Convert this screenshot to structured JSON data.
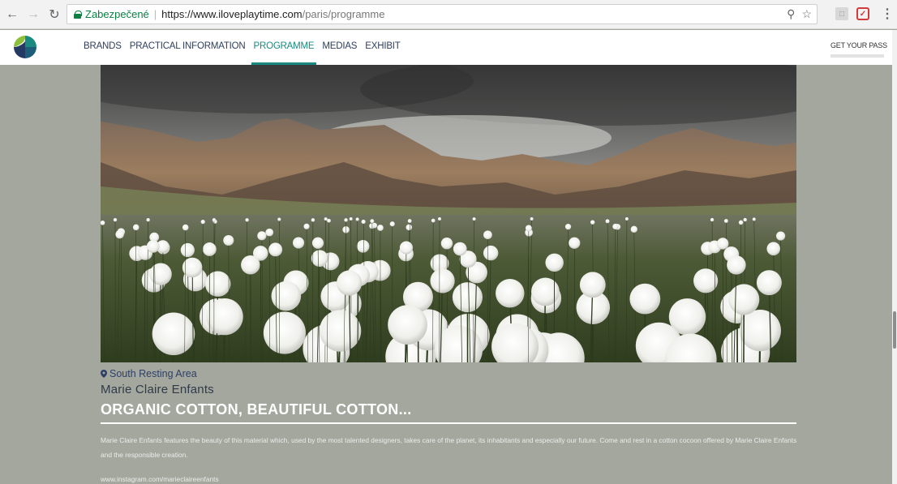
{
  "browser": {
    "secure_label": "Zabezpečené",
    "url_scheme_host": "https://www.iloveplaytime.com",
    "url_path": "/paris/programme"
  },
  "nav": {
    "links": [
      "BRANDS",
      "PRACTICAL INFORMATION",
      "PROGRAMME",
      "MEDIAS",
      "EXHIBIT"
    ],
    "active_index": 2,
    "cta": "GET YOUR PASS"
  },
  "event": {
    "location": "South Resting Area",
    "brand": "Marie Claire Enfants",
    "title": "ORGANIC COTTON, BEAUTIFUL COTTON...",
    "description": "Marie Claire Enfants features the beauty of this material which, used by the most talented designers, takes care of the planet, its inhabitants and especially our future. Come and rest in a cotton cocoon offered by Marie Claire Enfants and the responsible creation.",
    "link": "www.instagram.com/marieclaireenfants"
  },
  "colors": {
    "page_bg": "#a4a79d",
    "accent": "#1a8a80",
    "nav_text": "#2e3e5c",
    "secure_green": "#0b8043"
  },
  "icons": {
    "back": "arrow-left-icon",
    "forward": "arrow-right-icon",
    "reload": "reload-icon",
    "lock": "lock-icon",
    "zoom": "magnifier-icon",
    "bookmark": "star-icon",
    "location": "map-pin-icon"
  }
}
